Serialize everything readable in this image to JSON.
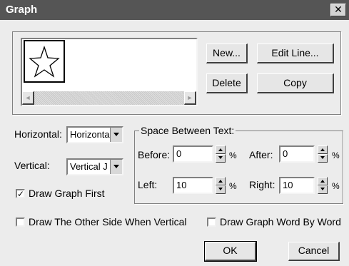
{
  "window": {
    "title": "Graph",
    "close_glyph": "✕"
  },
  "preview": {
    "icon": "star-icon",
    "scroll_left": "◄",
    "scroll_right": "►"
  },
  "buttons": {
    "new": "New...",
    "edit_line": "Edit Line...",
    "delete": "Delete",
    "copy": "Copy",
    "ok": "OK",
    "cancel": "Cancel"
  },
  "horizontal": {
    "label": "Horizontal:",
    "value": "Horizontal"
  },
  "vertical": {
    "label": "Vertical:",
    "value": "Vertical J"
  },
  "space_group": {
    "title": "Space Between Text:",
    "before": {
      "label": "Before:",
      "value": "0",
      "unit": "%"
    },
    "after": {
      "label": "After:",
      "value": "0",
      "unit": "%"
    },
    "left": {
      "label": "Left:",
      "value": "10",
      "unit": "%"
    },
    "right": {
      "label": "Right:",
      "value": "10",
      "unit": "%"
    }
  },
  "checkboxes": {
    "draw_graph_first": {
      "label": "Draw Graph First",
      "checked": true
    },
    "draw_other_side": {
      "label": "Draw The Other Side When Vertical",
      "checked": false
    },
    "word_by_word": {
      "label": "Draw Graph Word By Word",
      "checked": false
    }
  }
}
